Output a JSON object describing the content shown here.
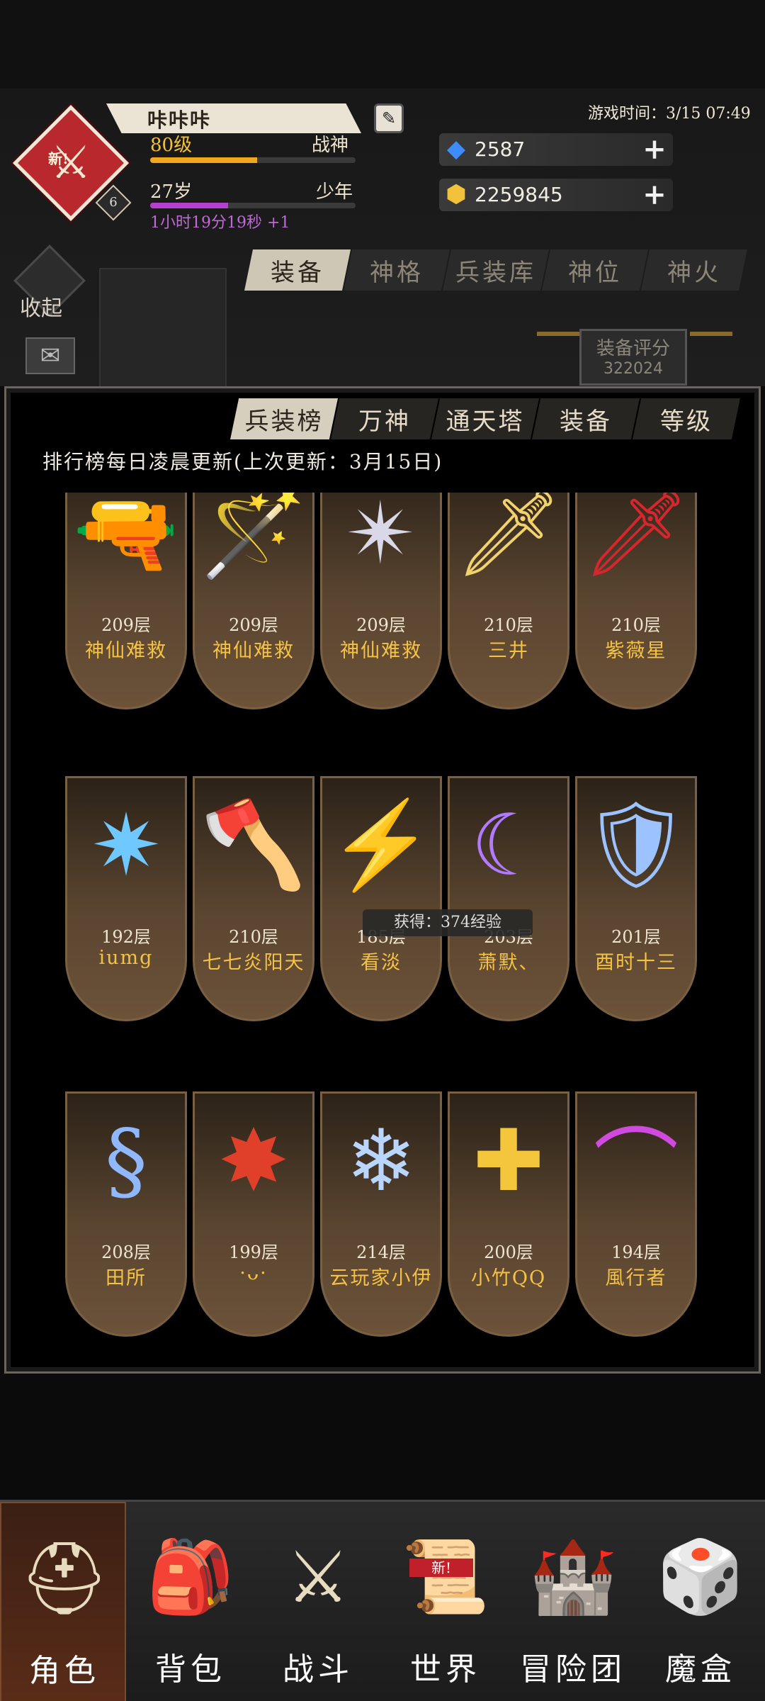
{
  "player": {
    "name": "咔咔咔",
    "badge_new": "新!",
    "badge_level": "6",
    "level": "80级",
    "title": "战神",
    "age": "27岁",
    "age_stage": "少年",
    "level_progress": 0.52,
    "age_progress": 0.38,
    "playtime": "1小时19分19秒 +1"
  },
  "game_time": "游戏时间：3/15 07:49",
  "resources": {
    "diamonds": "2587",
    "gold": "2259845"
  },
  "collapse_label": "收起",
  "top_tabs": [
    "装备",
    "神格",
    "兵装库",
    "神位",
    "神火"
  ],
  "score": {
    "label": "装备评分",
    "value": "322024"
  },
  "ranking_tabs": [
    "兵装榜",
    "万神",
    "通天塔",
    "装备",
    "等级"
  ],
  "notice": "排行榜每日凌晨更新(上次更新：3月15日)",
  "entries": [
    {
      "floor": "209层",
      "name": "神仙难救",
      "icon": "flame-gun-icon",
      "glyph": "🔫",
      "color": "#e0582a"
    },
    {
      "floor": "209层",
      "name": "神仙难救",
      "icon": "violet-staff-icon",
      "glyph": "🪄",
      "color": "#9b5cff"
    },
    {
      "floor": "209层",
      "name": "神仙难救",
      "icon": "shuriken-icon",
      "glyph": "✴",
      "color": "#d8d8e8"
    },
    {
      "floor": "210层",
      "name": "三井",
      "icon": "golden-sword-icon",
      "glyph": "🗡",
      "color": "#f2d36b"
    },
    {
      "floor": "210层",
      "name": "紫薇星",
      "icon": "crimson-blade-icon",
      "glyph": "🗡",
      "color": "#d8262e"
    },
    {
      "floor": "192层",
      "name": "iumg",
      "icon": "ice-star-icon",
      "glyph": "✷",
      "color": "#6fc8ff"
    },
    {
      "floor": "210层",
      "name": "七七炎阳天",
      "icon": "frost-axe-icon",
      "glyph": "🪓",
      "color": "#4aa0ff"
    },
    {
      "floor": "185层",
      "name": "看淡",
      "icon": "lightning-spear-icon",
      "glyph": "⚡",
      "color": "#9fe8ff"
    },
    {
      "floor": "203层",
      "name": "萧默、",
      "icon": "scythe-icon",
      "glyph": "☾",
      "color": "#b27bff"
    },
    {
      "floor": "201层",
      "name": "酉时十三",
      "icon": "rune-shield-icon",
      "glyph": "🛡",
      "color": "#9cc2ff"
    },
    {
      "floor": "208层",
      "name": "田所",
      "icon": "chain-whip-icon",
      "glyph": "§",
      "color": "#8fb8ff"
    },
    {
      "floor": "199层",
      "name": "·ᴗ·",
      "icon": "thorn-staff-icon",
      "glyph": "✸",
      "color": "#e0402a"
    },
    {
      "floor": "214层",
      "name": "云玩家小伊",
      "icon": "crystal-wand-icon",
      "glyph": "❄",
      "color": "#b8d6ff"
    },
    {
      "floor": "200层",
      "name": "小竹QQ",
      "icon": "holy-cross-icon",
      "glyph": "✚",
      "color": "#f3c63b"
    },
    {
      "floor": "194层",
      "name": "風行者",
      "icon": "purple-bow-icon",
      "glyph": "⌒",
      "color": "#d04adf"
    }
  ],
  "toast": "获得：374经验",
  "nav": [
    {
      "label": "角色",
      "icon": "helmet-icon",
      "glyph": "⛑"
    },
    {
      "label": "背包",
      "icon": "backpack-icon",
      "glyph": "🎒"
    },
    {
      "label": "战斗",
      "icon": "sword-shield-icon",
      "glyph": "⚔"
    },
    {
      "label": "世界",
      "icon": "scroll-icon",
      "glyph": "📜",
      "badge": "新!"
    },
    {
      "label": "冒险团",
      "icon": "castle-icon",
      "glyph": "🏰"
    },
    {
      "label": "魔盒",
      "icon": "magic-box-icon",
      "glyph": "🎲"
    }
  ]
}
